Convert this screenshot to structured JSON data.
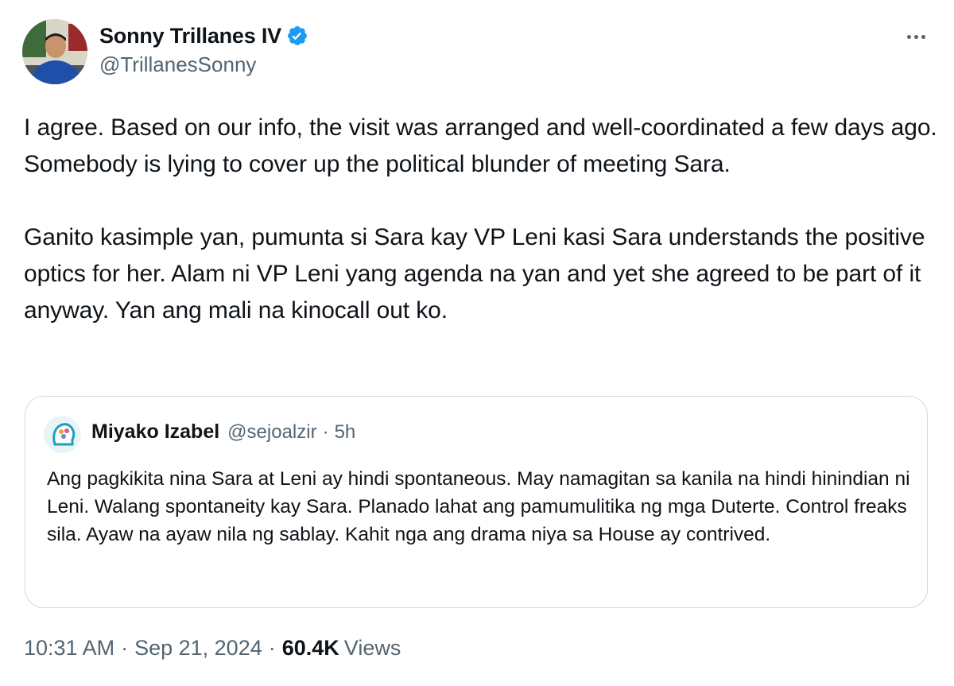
{
  "author": {
    "display_name": "Sonny Trillanes IV",
    "handle": "@TrillanesSonny",
    "avatar_icon": "profile-photo",
    "verified_icon": "verified-badge-icon",
    "verified_color": "#1d9bf0"
  },
  "menu": {
    "more_icon": "more-options-icon"
  },
  "tweet": {
    "text": "I agree. Based on our info, the visit was arranged and well-coordinated a few days ago. Somebody is lying to cover up the political blunder of meeting Sara.\n\nGanito kasimple yan, pumunta si Sara kay VP Leni kasi Sara understands the positive optics for her. Alam ni VP Leni yang agenda na yan and yet she agreed to be part of it anyway. Yan ang mali na kinocall out ko."
  },
  "quote": {
    "display_name": "Miyako Izabel",
    "handle": "@sejoalzir",
    "separator": "·",
    "time": "5h",
    "text": "Ang pagkikita nina Sara at Leni ay hindi spontaneous. May namagitan sa kanila na hindi hinindian ni Leni. Walang spontaneity kay Sara. Planado lahat ang pamumulitika ng mga Duterte. Control freaks sila. Ayaw na ayaw nila ng sablay. Kahit nga ang drama niya sa House ay contrived."
  },
  "meta": {
    "time": "10:31 AM",
    "separator": "·",
    "date": "Sep 21, 2024",
    "views_count": "60.4K",
    "views_label": "Views"
  },
  "colors": {
    "text_primary": "#0f1419",
    "text_secondary": "#536471",
    "border": "#cfd9de",
    "accent": "#1d9bf0"
  }
}
